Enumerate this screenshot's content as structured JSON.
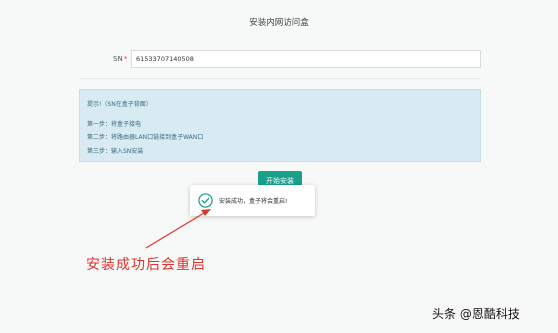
{
  "page": {
    "title": "安装内网访问盒"
  },
  "form": {
    "sn_label": "SN",
    "required_mark": "*",
    "sn_value": "61533707140508"
  },
  "tip": {
    "heading": "提示!（SN在盒子背面）",
    "steps": [
      "第一步：将盒子接电",
      "第二步：将路由器LAN口链接到盒子WAN口",
      "第三步：输入SN安装"
    ]
  },
  "actions": {
    "start_label": "开始安装"
  },
  "toast": {
    "icon": "check-circle-icon",
    "message": "安装成功，盒子将会重启!"
  },
  "annotation": {
    "text": "安装成功后会重启"
  },
  "watermark": {
    "text": "头条 @恩酷科技"
  },
  "colors": {
    "accent": "#17a08a",
    "tip_bg": "#d8ebf3",
    "annotation": "#e0332e"
  }
}
